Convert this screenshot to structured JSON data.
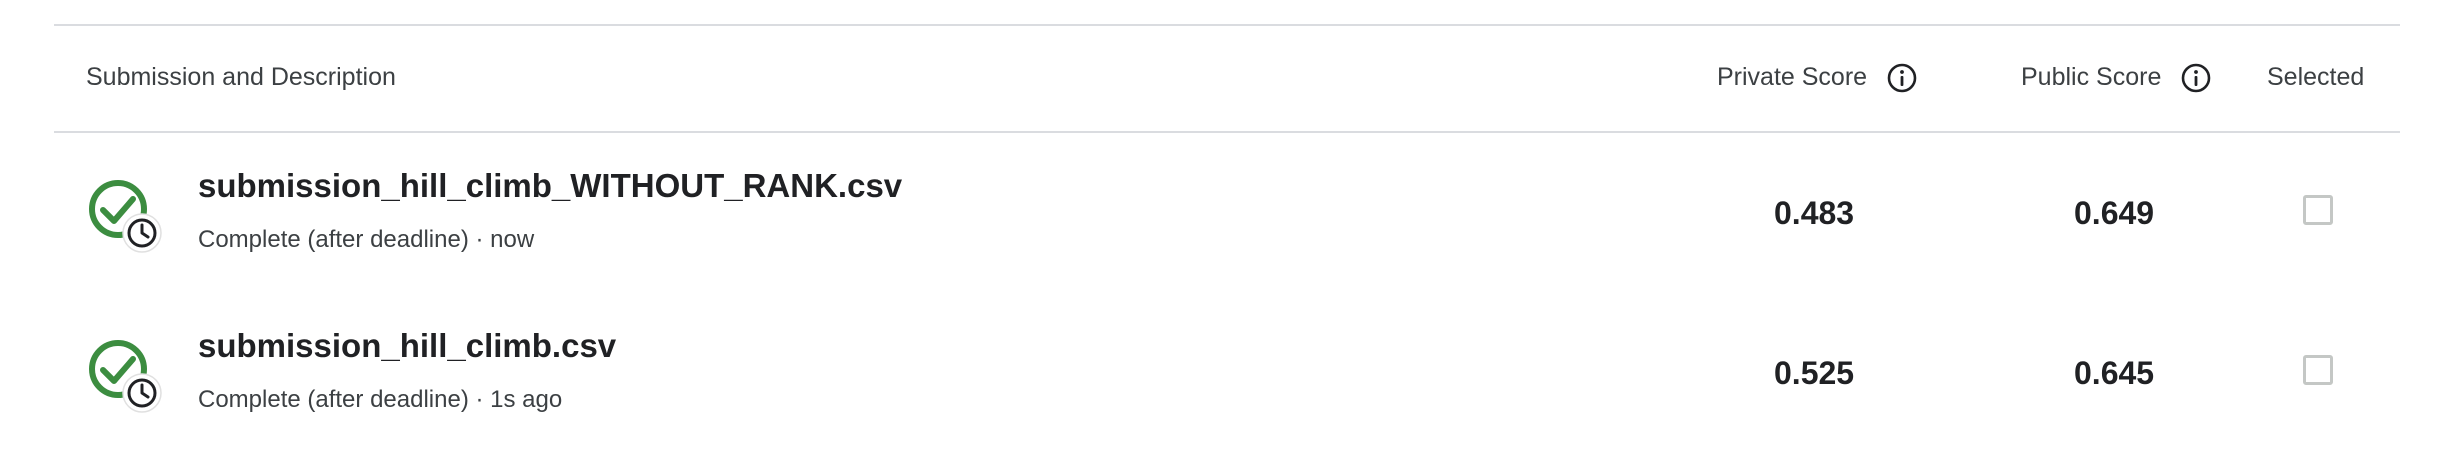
{
  "table": {
    "columns": {
      "description": "Submission and Description",
      "private_score": "Private Score",
      "public_score": "Public Score",
      "selected": "Selected"
    },
    "rows": [
      {
        "filename": "submission_hill_climb_WITHOUT_RANK.csv",
        "status_line": "Complete (after deadline) · now",
        "private_score": "0.483",
        "public_score": "0.649",
        "selected": false,
        "status_icon": "check-circle-with-clock-icon"
      },
      {
        "filename": "submission_hill_climb.csv",
        "status_line": "Complete (after deadline) · 1s ago",
        "private_score": "0.525",
        "public_score": "0.645",
        "selected": false,
        "status_icon": "check-circle-with-clock-icon"
      }
    ]
  },
  "colors": {
    "success_green": "#3c8d40",
    "divider": "#dadce0",
    "text_primary": "#202124",
    "text_secondary": "#3c4043",
    "checkbox_border": "#c4c7c5"
  }
}
